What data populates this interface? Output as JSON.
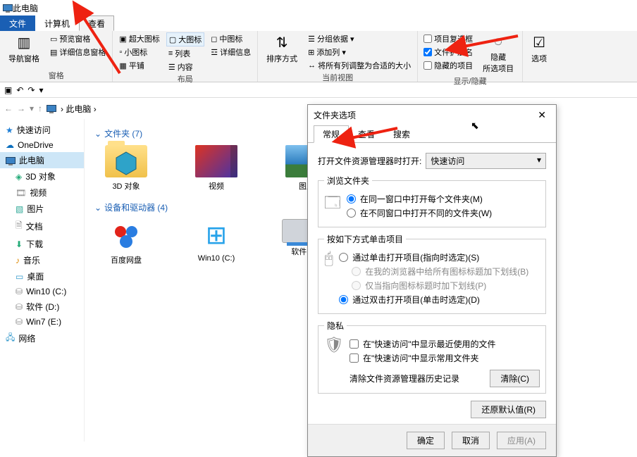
{
  "titlebar": {
    "title": "此电脑"
  },
  "ribbon_tabs": {
    "file": "文件",
    "computer": "计算机",
    "view": "查看"
  },
  "ribbon": {
    "panes": {
      "nav": "导航窗格",
      "preview": "预览窗格",
      "details": "详细信息窗格",
      "label": "窗格"
    },
    "layout": {
      "xl": "超大图标",
      "lg": "大图标",
      "md": "中图标",
      "sm": "小图标",
      "list": "列表",
      "details": "详细信息",
      "tiles": "平铺",
      "content": "内容",
      "label": "布局"
    },
    "current_view": {
      "sort": "排序方式",
      "groupby": "分组依据",
      "addcol": "添加列",
      "sizeall": "将所有列调整为合适的大小",
      "label": "当前视图"
    },
    "showhide": {
      "itemchk": "项目复选框",
      "ext": "文件扩展名",
      "hidden_items": "隐藏的项目",
      "hide_btn": "隐藏\n所选项目",
      "label": "显示/隐藏"
    },
    "options": {
      "options": "选项"
    }
  },
  "breadcrumb": {
    "root": "此电脑"
  },
  "sidebar": {
    "quick": "快速访问",
    "onedrive": "OneDrive",
    "thispc": "此电脑",
    "obj3d": "3D 对象",
    "videos": "视频",
    "pictures": "图片",
    "documents": "文档",
    "downloads": "下载",
    "music": "音乐",
    "desktop": "桌面",
    "win10c": "Win10 (C:)",
    "softd": "软件 (D:)",
    "win7e": "Win7 (E:)",
    "network": "网络"
  },
  "content": {
    "folders_head": "文件夹 (7)",
    "drives_head": "设备和驱动器 (4)",
    "items": {
      "obj3d": "3D 对象",
      "videos": "视频",
      "pictures": "图片",
      "baidu": "百度网盘",
      "win10": "Win10 (C:)",
      "soft": "软件 (D:)"
    }
  },
  "dialog": {
    "title": "文件夹选项",
    "tabs": {
      "general": "常规",
      "view": "查看",
      "search": "搜索"
    },
    "openwith_label": "打开文件资源管理器时打开:",
    "openwith_value": "快速访问",
    "browse": {
      "legend": "浏览文件夹",
      "same": "在同一窗口中打开每个文件夹(M)",
      "new": "在不同窗口中打开不同的文件夹(W)"
    },
    "click": {
      "legend": "按如下方式单击项目",
      "single": "通过单击打开项目(指向时选定)(S)",
      "under1": "在我的浏览器中给所有图标标题加下划线(B)",
      "under2": "仅当指向图标标题时加下划线(P)",
      "double": "通过双击打开项目(单击时选定)(D)"
    },
    "privacy": {
      "legend": "隐私",
      "recent": "在\"快速访问\"中显示最近使用的文件",
      "freq": "在\"快速访问\"中显示常用文件夹",
      "clear_label": "清除文件资源管理器历史记录",
      "clear": "清除(C)"
    },
    "restore": "还原默认值(R)",
    "ok": "确定",
    "cancel": "取消",
    "apply": "应用(A)"
  }
}
